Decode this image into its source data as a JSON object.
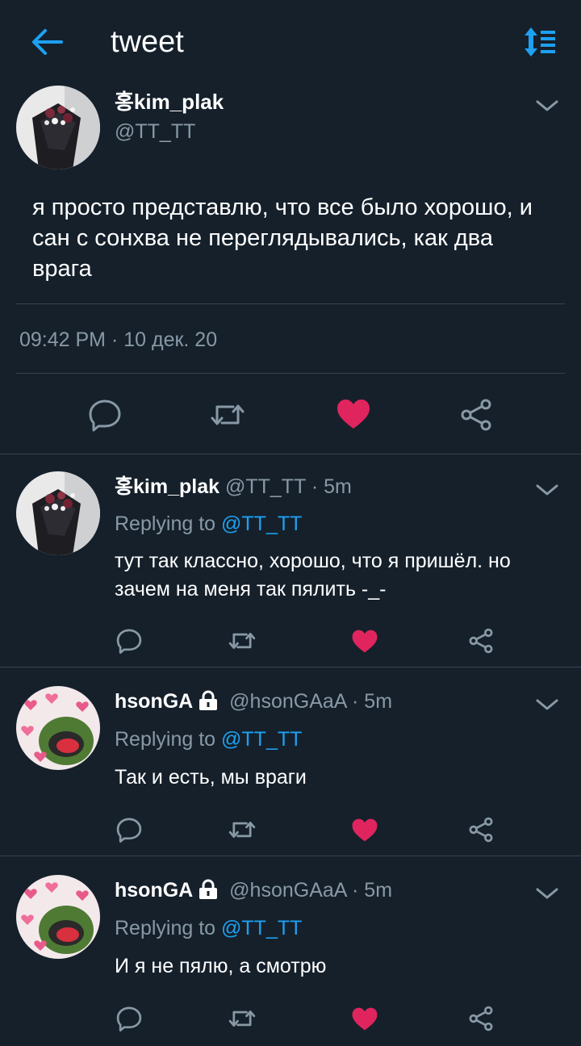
{
  "header": {
    "title": "tweet"
  },
  "main_tweet": {
    "name": "홍kim_plak",
    "handle": "@TT_TT",
    "text": "я просто представлю, что все было хорошо, и сан с сонхва не переглядывались, как два врага",
    "timestamp": "09:42 PM · 10 дек. 20",
    "liked": true
  },
  "replies": [
    {
      "name": "홍kim_plak",
      "handle_time": "@TT_TT · 5m",
      "locked": false,
      "replying_prefix": "Replying to",
      "replying_to": "@TT_TT",
      "text": "тут так классно, хорошо, что я пришёл. но зачем на меня так пялить -_-",
      "liked": true
    },
    {
      "name": "hsonGA",
      "handle_time": "@hsonGAaA · 5m",
      "locked": true,
      "replying_prefix": "Replying to",
      "replying_to": "@TT_TT",
      "text": "Так и есть, мы враги",
      "liked": true
    },
    {
      "name": "hsonGA",
      "handle_time": "@hsonGAaA · 5m",
      "locked": true,
      "replying_prefix": "Replying to",
      "replying_to": "@TT_TT",
      "text": "И я не пялю, а смотрю",
      "liked": true
    }
  ],
  "colors": {
    "background": "#15202b",
    "accent": "#1da1f2",
    "like": "#e0245e",
    "muted": "#8899a6",
    "divider": "#38444d"
  },
  "icons": [
    "back-arrow-icon",
    "sort-icon",
    "chevron-down-icon",
    "reply-icon",
    "retweet-icon",
    "heart-icon",
    "share-icon",
    "lock-icon"
  ]
}
